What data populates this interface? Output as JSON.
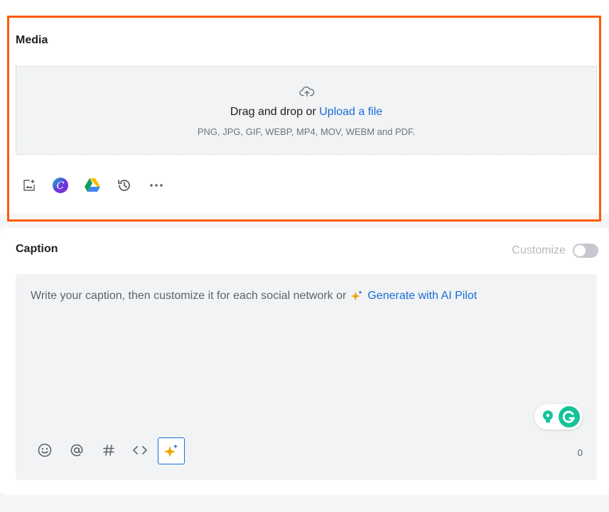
{
  "media": {
    "title": "Media",
    "drop_text": "Drag and drop or",
    "upload_link": "Upload a file",
    "formats": "PNG, JPG, GIF, WEBP, MP4, MOV, WEBM and PDF.",
    "tools": [
      "add-image-icon",
      "canva-icon",
      "google-drive-icon",
      "history-icon",
      "more-icon"
    ],
    "highlight_color": "#ff5a00"
  },
  "caption": {
    "title": "Caption",
    "customize_label": "Customize",
    "customize_on": false,
    "placeholder": "Write your caption, then customize it for each social network or",
    "ai_link": "Generate with AI Pilot",
    "char_count": "0",
    "tools": [
      "emoji-icon",
      "mention-icon",
      "hashtag-icon",
      "code-icon",
      "ai-sparkle-icon"
    ]
  },
  "colors": {
    "link": "#1a6dd6",
    "grammarly": "#15c39a",
    "sparkle": "#f0a500"
  }
}
